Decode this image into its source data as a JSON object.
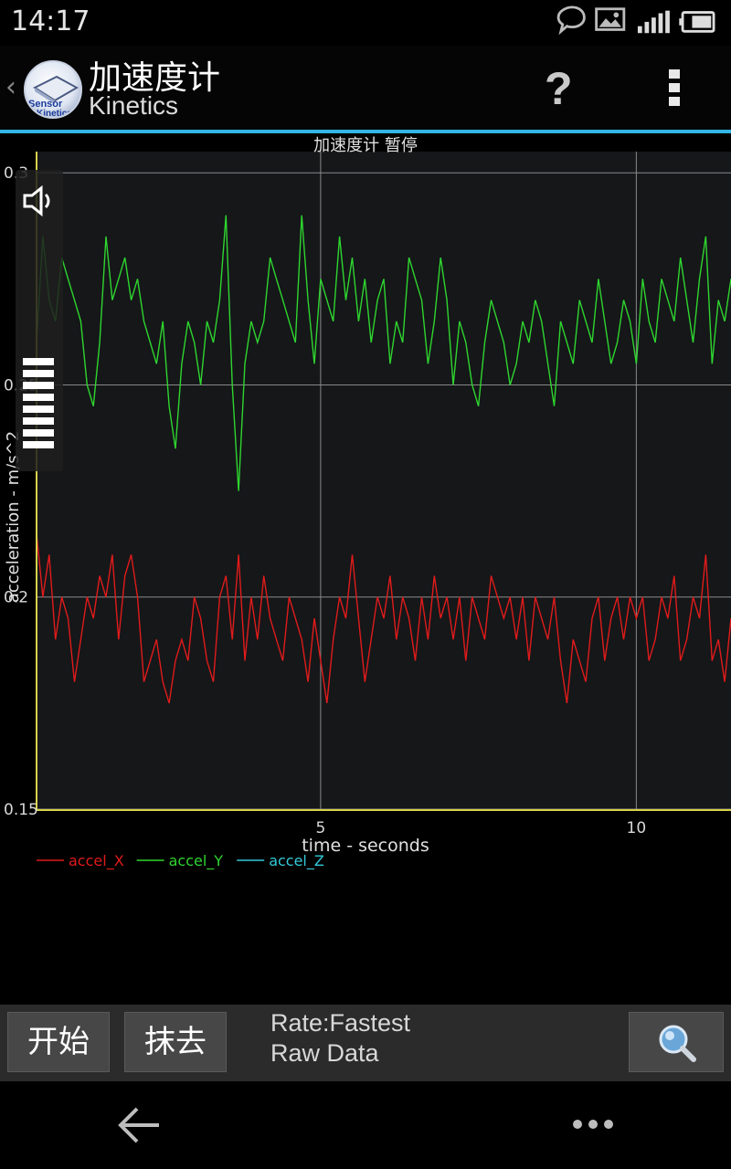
{
  "status_bar": {
    "time": "14:17",
    "icons": [
      "chat-bubble-icon",
      "image-icon",
      "signal-icon",
      "battery-icon"
    ]
  },
  "action_bar": {
    "title": "加速度计",
    "subtitle": "Kinetics",
    "logo_text_top": "Sensor",
    "logo_text_bottom": "Kinetics",
    "help_label": "?"
  },
  "chart_data": {
    "type": "line",
    "title": "加速度计 暂停",
    "xlabel": "time - seconds",
    "ylabel": "acceleration - m/s^2",
    "xlim": [
      0.5,
      11.5
    ],
    "ylim": [
      0.15,
      0.305
    ],
    "x_ticks": [
      5,
      10
    ],
    "y_ticks": [
      0.15,
      0.2,
      0.25,
      0.3
    ],
    "y_tick_labels": [
      "0.15",
      "0.2",
      "0.25",
      "0.3"
    ],
    "grid": true,
    "legend_position": "bottom-left",
    "series": [
      {
        "name": "accel_X",
        "color": "#e01b1b",
        "x": [
          0.5,
          0.6,
          0.7,
          0.8,
          0.9,
          1.0,
          1.1,
          1.2,
          1.3,
          1.4,
          1.5,
          1.6,
          1.7,
          1.8,
          1.9,
          2.0,
          2.1,
          2.2,
          2.3,
          2.4,
          2.5,
          2.6,
          2.7,
          2.8,
          2.9,
          3.0,
          3.1,
          3.2,
          3.3,
          3.4,
          3.5,
          3.6,
          3.7,
          3.8,
          3.9,
          4.0,
          4.1,
          4.2,
          4.3,
          4.4,
          4.5,
          4.6,
          4.7,
          4.8,
          4.9,
          5.0,
          5.1,
          5.2,
          5.3,
          5.4,
          5.5,
          5.6,
          5.7,
          5.8,
          5.9,
          6.0,
          6.1,
          6.2,
          6.3,
          6.4,
          6.5,
          6.6,
          6.7,
          6.8,
          6.9,
          7.0,
          7.1,
          7.2,
          7.3,
          7.4,
          7.5,
          7.6,
          7.7,
          7.8,
          7.9,
          8.0,
          8.1,
          8.2,
          8.3,
          8.4,
          8.5,
          8.6,
          8.7,
          8.8,
          8.9,
          9.0,
          9.1,
          9.2,
          9.3,
          9.4,
          9.5,
          9.6,
          9.7,
          9.8,
          9.9,
          10.0,
          10.1,
          10.2,
          10.3,
          10.4,
          10.5,
          10.6,
          10.7,
          10.8,
          10.9,
          11.0,
          11.1,
          11.2,
          11.3,
          11.4,
          11.5
        ],
        "values": [
          0.215,
          0.2,
          0.21,
          0.19,
          0.2,
          0.195,
          0.18,
          0.19,
          0.2,
          0.195,
          0.205,
          0.2,
          0.21,
          0.19,
          0.205,
          0.21,
          0.2,
          0.18,
          0.185,
          0.19,
          0.18,
          0.175,
          0.185,
          0.19,
          0.185,
          0.2,
          0.195,
          0.185,
          0.18,
          0.2,
          0.205,
          0.19,
          0.21,
          0.185,
          0.2,
          0.19,
          0.205,
          0.195,
          0.19,
          0.185,
          0.2,
          0.195,
          0.19,
          0.18,
          0.195,
          0.185,
          0.175,
          0.19,
          0.2,
          0.195,
          0.21,
          0.195,
          0.18,
          0.19,
          0.2,
          0.195,
          0.205,
          0.19,
          0.2,
          0.195,
          0.185,
          0.2,
          0.19,
          0.205,
          0.195,
          0.2,
          0.19,
          0.2,
          0.185,
          0.2,
          0.195,
          0.19,
          0.205,
          0.2,
          0.195,
          0.2,
          0.19,
          0.2,
          0.185,
          0.2,
          0.195,
          0.19,
          0.2,
          0.185,
          0.175,
          0.19,
          0.185,
          0.18,
          0.195,
          0.2,
          0.185,
          0.195,
          0.2,
          0.19,
          0.2,
          0.195,
          0.2,
          0.185,
          0.19,
          0.2,
          0.195,
          0.205,
          0.185,
          0.19,
          0.2,
          0.195,
          0.21,
          0.185,
          0.19,
          0.18,
          0.195
        ]
      },
      {
        "name": "accel_Y",
        "color": "#2fd52f",
        "x": [
          0.5,
          0.6,
          0.7,
          0.8,
          0.9,
          1.0,
          1.1,
          1.2,
          1.3,
          1.4,
          1.5,
          1.6,
          1.7,
          1.8,
          1.9,
          2.0,
          2.1,
          2.2,
          2.3,
          2.4,
          2.5,
          2.6,
          2.7,
          2.8,
          2.9,
          3.0,
          3.1,
          3.2,
          3.3,
          3.4,
          3.5,
          3.6,
          3.7,
          3.8,
          3.9,
          4.0,
          4.1,
          4.2,
          4.3,
          4.4,
          4.5,
          4.6,
          4.7,
          4.8,
          4.9,
          5.0,
          5.1,
          5.2,
          5.3,
          5.4,
          5.5,
          5.6,
          5.7,
          5.8,
          5.9,
          6.0,
          6.1,
          6.2,
          6.3,
          6.4,
          6.5,
          6.6,
          6.7,
          6.8,
          6.9,
          7.0,
          7.1,
          7.2,
          7.3,
          7.4,
          7.5,
          7.6,
          7.7,
          7.8,
          7.9,
          8.0,
          8.1,
          8.2,
          8.3,
          8.4,
          8.5,
          8.6,
          8.7,
          8.8,
          8.9,
          9.0,
          9.1,
          9.2,
          9.3,
          9.4,
          9.5,
          9.6,
          9.7,
          9.8,
          9.9,
          10.0,
          10.1,
          10.2,
          10.3,
          10.4,
          10.5,
          10.6,
          10.7,
          10.8,
          10.9,
          11.0,
          11.1,
          11.2,
          11.3,
          11.4,
          11.5
        ],
        "values": [
          0.26,
          0.285,
          0.27,
          0.265,
          0.28,
          0.275,
          0.27,
          0.265,
          0.25,
          0.245,
          0.26,
          0.285,
          0.27,
          0.275,
          0.28,
          0.27,
          0.275,
          0.265,
          0.26,
          0.255,
          0.265,
          0.245,
          0.235,
          0.255,
          0.265,
          0.26,
          0.25,
          0.265,
          0.26,
          0.27,
          0.29,
          0.25,
          0.225,
          0.255,
          0.265,
          0.26,
          0.265,
          0.28,
          0.275,
          0.27,
          0.265,
          0.26,
          0.29,
          0.27,
          0.255,
          0.275,
          0.27,
          0.265,
          0.285,
          0.27,
          0.28,
          0.265,
          0.275,
          0.26,
          0.27,
          0.275,
          0.255,
          0.265,
          0.26,
          0.28,
          0.275,
          0.27,
          0.255,
          0.265,
          0.28,
          0.27,
          0.25,
          0.265,
          0.26,
          0.25,
          0.245,
          0.26,
          0.27,
          0.265,
          0.26,
          0.25,
          0.255,
          0.265,
          0.26,
          0.27,
          0.265,
          0.255,
          0.245,
          0.265,
          0.26,
          0.255,
          0.27,
          0.265,
          0.26,
          0.275,
          0.265,
          0.255,
          0.26,
          0.27,
          0.265,
          0.255,
          0.275,
          0.265,
          0.26,
          0.275,
          0.27,
          0.265,
          0.28,
          0.27,
          0.26,
          0.275,
          0.285,
          0.255,
          0.27,
          0.265,
          0.275
        ]
      },
      {
        "name": "accel_Z",
        "color": "#33c9d9",
        "x": [],
        "values": []
      }
    ]
  },
  "toolbar": {
    "start_label": "开始",
    "erase_label": "抹去",
    "rate_text": "Rate:Fastest",
    "mode_text": "Raw Data"
  }
}
